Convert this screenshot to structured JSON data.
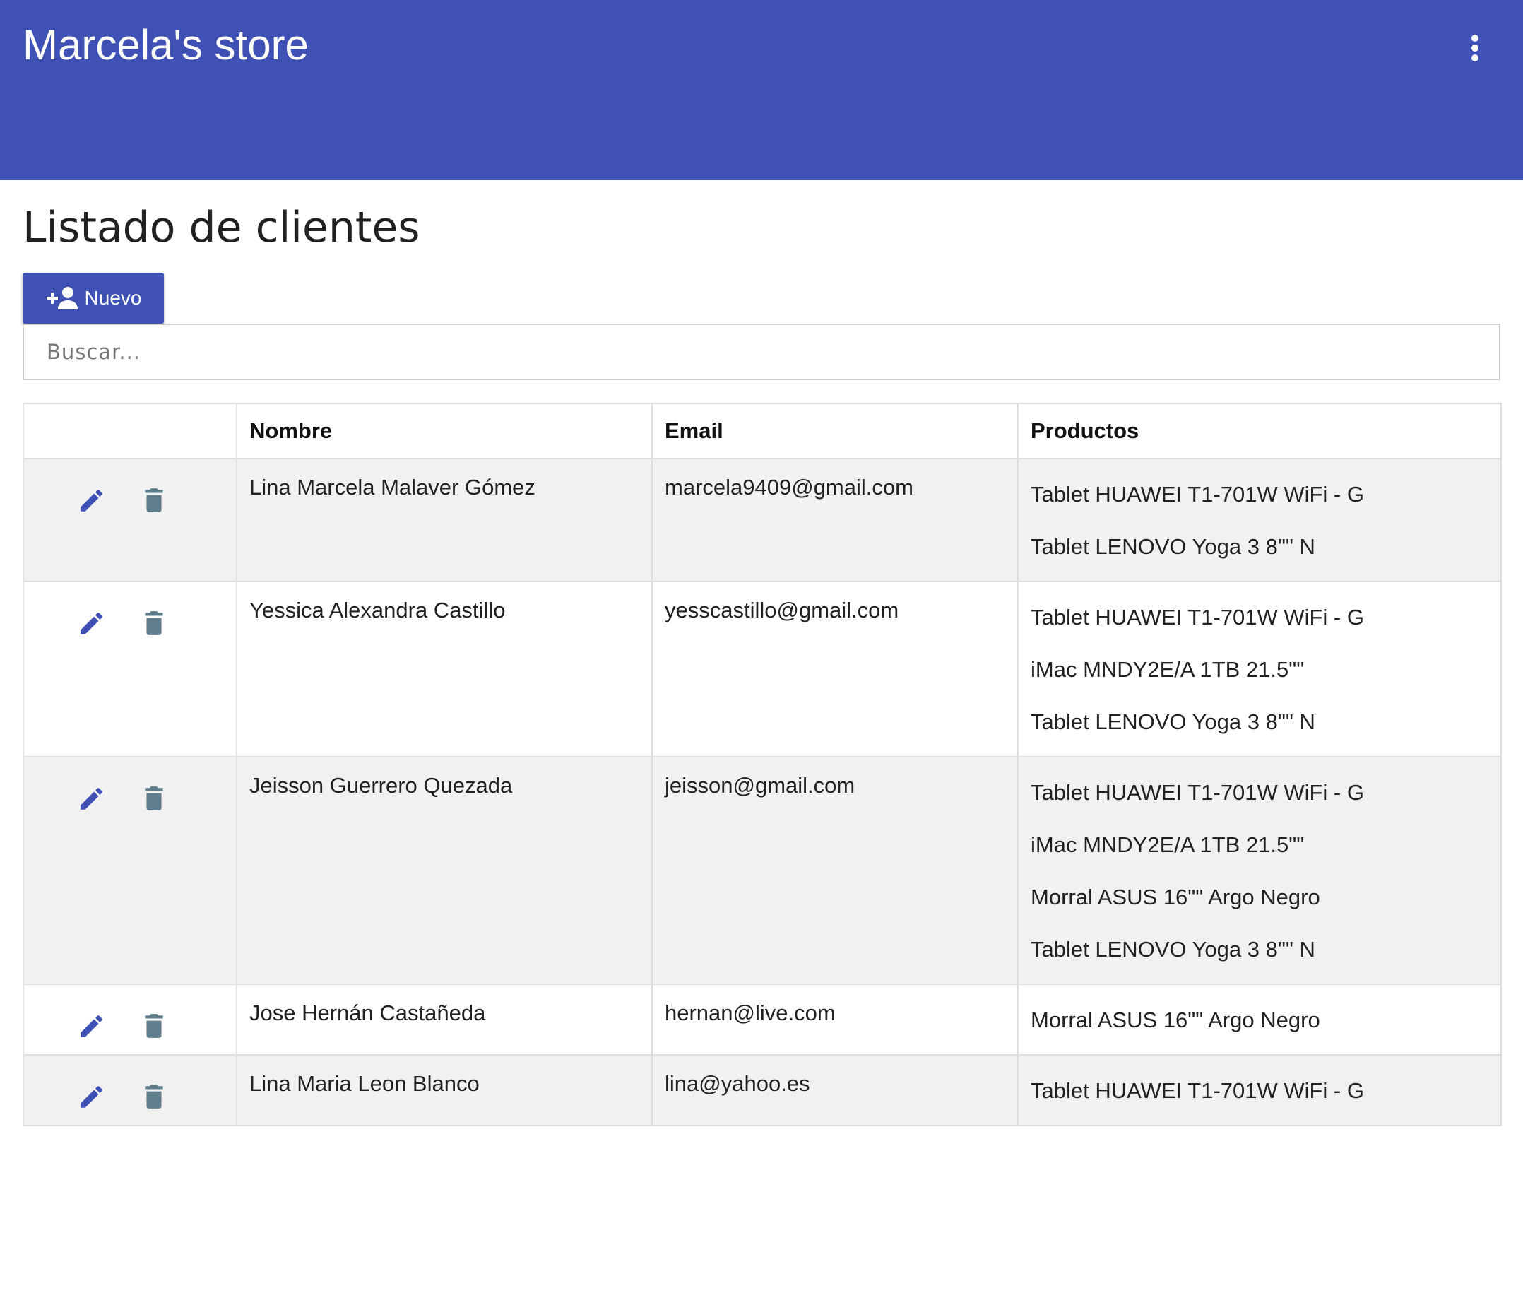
{
  "app": {
    "title": "Marcela's store",
    "menu_icon": "more-vert-icon",
    "brand_color": "#3f51b5"
  },
  "main": {
    "title": "Listado de clientes",
    "new_button_label": "Nuevo",
    "new_button_icon": "person-add-icon",
    "search_placeholder": "Buscar...",
    "search_value": ""
  },
  "table": {
    "columns": [
      "",
      "Nombre",
      "Email",
      "Productos"
    ],
    "row_action_icons": [
      "edit-pencil-icon",
      "delete-trash-icon"
    ],
    "rows": [
      {
        "name": "Lina Marcela Malaver Gómez",
        "email": "marcela9409@gmail.com",
        "products": [
          "Tablet HUAWEI T1-701W WiFi - G",
          "Tablet LENOVO Yoga 3 8\"\" N"
        ]
      },
      {
        "name": "Yessica Alexandra Castillo",
        "email": "yesscastillo@gmail.com",
        "products": [
          "Tablet HUAWEI T1-701W WiFi - G",
          "iMac MNDY2E/A 1TB 21.5\"\"",
          "Tablet LENOVO Yoga 3 8\"\" N"
        ]
      },
      {
        "name": "Jeisson Guerrero Quezada",
        "email": "jeisson@gmail.com",
        "products": [
          "Tablet HUAWEI T1-701W WiFi - G",
          "iMac MNDY2E/A 1TB 21.5\"\"",
          "Morral ASUS 16\"\" Argo Negro",
          "Tablet LENOVO Yoga 3 8\"\" N"
        ]
      },
      {
        "name": "Jose Hernán Castañeda",
        "email": "hernan@live.com",
        "products": [
          "Morral ASUS 16\"\" Argo Negro"
        ]
      },
      {
        "name": "Lina Maria Leon Blanco",
        "email": "lina@yahoo.es",
        "products": [
          "Tablet HUAWEI T1-701W WiFi - G"
        ]
      }
    ]
  },
  "colors": {
    "edit_icon": "#3f51b5",
    "delete_icon": "#607d8b",
    "row_stripe": "#f1f1f1"
  }
}
